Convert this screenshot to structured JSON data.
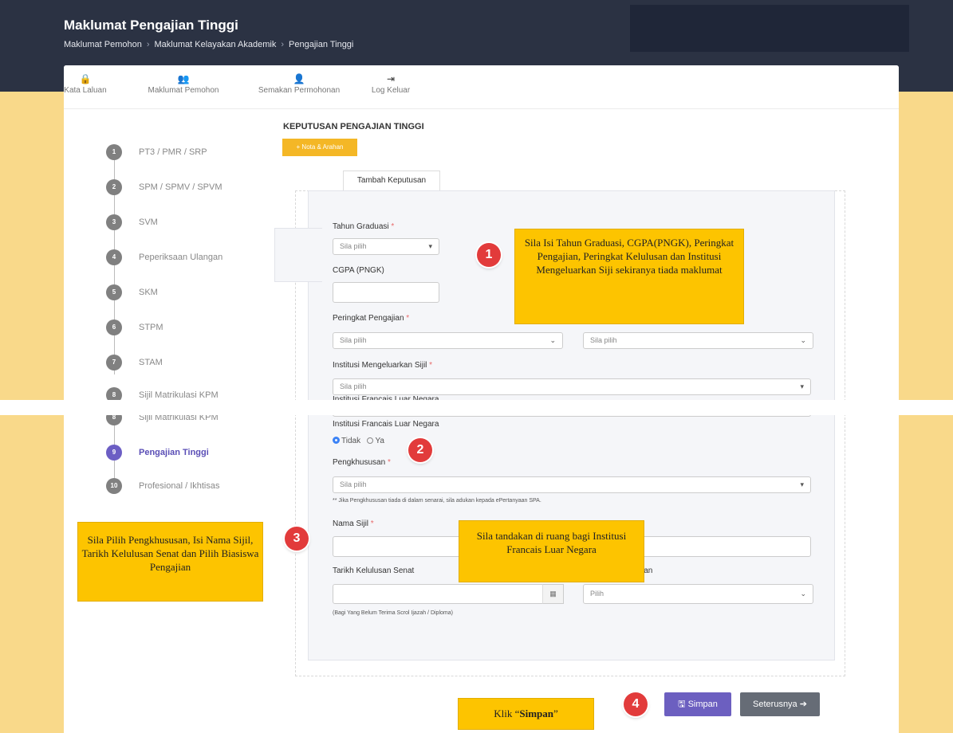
{
  "header": {
    "title": "Maklumat Pengajian Tinggi",
    "breadcrumb": [
      "Maklumat Pemohon",
      "Maklumat Kelayakan Akademik",
      "Pengajian Tinggi"
    ]
  },
  "topnav": [
    {
      "label": "Kata Laluan",
      "icon": "lock-icon",
      "glyph": "🔒"
    },
    {
      "label": "Maklumat Pemohon",
      "icon": "users-icon",
      "glyph": "👥"
    },
    {
      "label": "Semakan Permohonan",
      "icon": "user-check-icon",
      "glyph": "👤"
    },
    {
      "label": "Log Keluar",
      "icon": "sign-out-icon",
      "glyph": "⇥"
    }
  ],
  "steps": [
    {
      "num": "1",
      "label": "PT3 / PMR / SRP"
    },
    {
      "num": "2",
      "label": "SPM / SPMV / SPVM"
    },
    {
      "num": "3",
      "label": "SVM"
    },
    {
      "num": "4",
      "label": "Peperiksaan Ulangan"
    },
    {
      "num": "5",
      "label": "SKM"
    },
    {
      "num": "6",
      "label": "STPM"
    },
    {
      "num": "7",
      "label": "STAM"
    },
    {
      "num": "8",
      "label": "Sijil Matrikulasi KPM"
    },
    {
      "num": "9",
      "label": "Pengajian Tinggi"
    },
    {
      "num": "10",
      "label": "Profesional / Ikhtisas"
    }
  ],
  "main": {
    "section_title": "KEPUTUSAN PENGAJIAN TINGGI",
    "nota_button": "+ Nota & Arahan",
    "tab_label": "Tambah Keputusan"
  },
  "form": {
    "tahun_label": "Tahun Graduasi",
    "required_mark": "*",
    "tahun_value": "Sila pilih",
    "cgpa_label": "CGPA (PNGK)",
    "peringkat_label": "Peringkat Pengajian",
    "peringkat_value": "Sila pilih",
    "peringkat_value2": "Sila pilih",
    "institusi_label": "Institusi Mengeluarkan Sijil",
    "institusi_value": "Sila pilih",
    "francais_label": "Institusi Francais Luar Negara",
    "radio_tidak": "Tidak",
    "radio_ya": "Ya",
    "pengkhususan_label": "Pengkhususan",
    "pengkhususan_value": "Sila pilih",
    "pengkhususan_note": "** Jika Pengkhususan tiada di dalam senarai, sila adukan kepada ePertanyaan SPA.",
    "nama_sijil_label": "Nama Sijil",
    "tarikh_label": "Tarikh Kelulusan Senat",
    "biasiswa_label_partial": "ian",
    "biasiswa_value": "Pilih",
    "tarikh_note": "(Bagi Yang Belum Terima Scrol Ijazah / Diploma)"
  },
  "buttons": {
    "simpan": "Simpan",
    "seterusnya": "Seterusnya"
  },
  "annotations": {
    "badge1": "1",
    "badge2": "2",
    "badge3": "3",
    "badge4": "4",
    "callout1": "Sila Isi Tahun Graduasi, CGPA(PNGK), Peringkat Pengajian, Peringkat Kelulusan dan Institusi Mengeluarkan Siji sekiranya tiada maklumat",
    "callout2": "Sila tandakan di ruang bagi Institusi Francais Luar Negara",
    "callout3": "Sila Pilih Pengkhususan, Isi Nama Sijil, Tarikh Kelulusan Senat dan Pilih Biasiswa Pengajian",
    "callout4_prefix": "Klik “",
    "callout4_bold": "Simpan",
    "callout4_suffix": "”"
  }
}
